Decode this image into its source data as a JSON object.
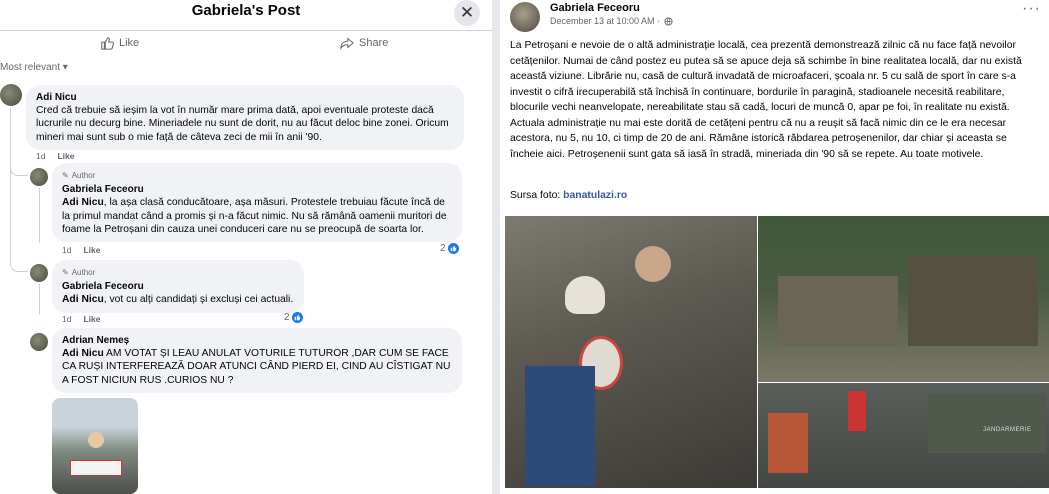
{
  "dialog": {
    "title": "Gabriela's Post",
    "close_symbol": "✕",
    "like_label": "Like",
    "share_label": "Share",
    "sort_label": "Most relevant ▾"
  },
  "comments": [
    {
      "author": "Adi Nicu",
      "text": "Cred că trebuie să ieșim la vot în număr mare prima dată, apoi eventuale proteste dacă lucrurile nu decurg bine. Mineriadele nu sunt de dorit, nu au făcut deloc bine zonei. Oricum mineri mai sunt sub o mie față de câteva zeci de mii în anii '90.",
      "time": "1d",
      "like_label": "Like"
    },
    {
      "badge": "Author",
      "author": "Gabriela Feceoru",
      "mention": "Adi Nicu",
      "text": ", la așa clasă conducătoare, așa măsuri. Protestele trebuiau făcute încă de la primul mandat când a promis și n-a făcut nimic. Nu să rămână oamenii muritori de foame la Petroșani din cauza unei conduceri care nu se preocupă de soarta lor.",
      "time": "1d",
      "like_label": "Like",
      "reactions": "2"
    },
    {
      "badge": "Author",
      "author": "Gabriela Feceoru",
      "mention": "Adi Nicu",
      "text": ", vot cu alți candidați și excluși cei actuali.",
      "time": "1d",
      "like_label": "Like",
      "reactions": "2"
    },
    {
      "author": "Adrian Nemeș",
      "mention": "Adi Nicu",
      "text": " AM VOTAT ȘI LEAU ANULAT VOTURILE TUTUROR ,DAR CUM SE FACE CA RUȘI INTERFEREAZĂ DOAR ATUNCI CÂND PIERD EI, CIND AU CÎSTIGAT NU A FOST NICIUN RUS .CURIOS NU ?"
    }
  ],
  "post": {
    "author": "Gabriela Feceoru",
    "date": "December 13 at 10:00 AM · ",
    "more_symbol": "···",
    "text": "La Petroșani e nevoie de o altă administrație locală, cea prezentă demonstrează zilnic că nu face față nevoilor cetățenilor. Numai de când postez eu putea să se apuce deja să schimbe în bine realitatea locală, dar nu există această viziune. Librărie nu, casă de cultură invadată de microafaceri, școala nr. 5 cu sală de sport în care s-a investit o cifră irecuperabilă stă închisă în continuare, bordurile în paragină, stadioanele necesită reabilitare, blocurile vechi neanvelopate, nereabilitate stau să cadă, locuri de muncă 0, apar pe foi, în realitate nu există. Actuala administrație nu mai este dorită de cetățeni pentru că nu a reușit să facă nimic din ce le era necesar acestora, nu 5, nu 10, ci timp de 20 de ani. Rămâne istorică răbdarea petroșenenilor, dar chiar și aceasta se încheie aici. Petroșenenii sunt gata să iasă în stradă, mineriada din '90 să se repete. Au toate motivele.",
    "source_label": "Sursa foto: ",
    "source_link": "banatulazi.ro",
    "photo_caption": "JANDARMERIE"
  },
  "colors": {
    "accent": "#1877f2",
    "link": "#385898",
    "bubble": "#f0f2f5",
    "muted": "#65676b"
  }
}
